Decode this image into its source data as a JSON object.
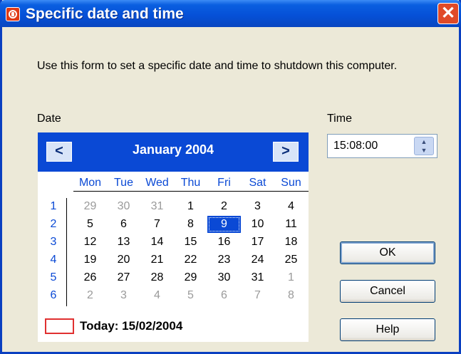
{
  "window": {
    "title": "Specific date and time"
  },
  "description": "Use this form to set a specific date and time to shutdown this computer.",
  "labels": {
    "date": "Date",
    "time": "Time"
  },
  "calendar": {
    "month_label": "January 2004",
    "prev_label": "<",
    "next_label": ">",
    "weekdays": [
      "Mon",
      "Tue",
      "Wed",
      "Thu",
      "Fri",
      "Sat",
      "Sun"
    ],
    "weeks": [
      {
        "num": "1",
        "days": [
          {
            "d": "29",
            "other": true
          },
          {
            "d": "30",
            "other": true
          },
          {
            "d": "31",
            "other": true
          },
          {
            "d": "1"
          },
          {
            "d": "2"
          },
          {
            "d": "3"
          },
          {
            "d": "4"
          }
        ]
      },
      {
        "num": "2",
        "days": [
          {
            "d": "5"
          },
          {
            "d": "6"
          },
          {
            "d": "7"
          },
          {
            "d": "8"
          },
          {
            "d": "9",
            "selected": true
          },
          {
            "d": "10"
          },
          {
            "d": "11"
          }
        ]
      },
      {
        "num": "3",
        "days": [
          {
            "d": "12"
          },
          {
            "d": "13"
          },
          {
            "d": "14"
          },
          {
            "d": "15"
          },
          {
            "d": "16"
          },
          {
            "d": "17"
          },
          {
            "d": "18"
          }
        ]
      },
      {
        "num": "4",
        "days": [
          {
            "d": "19"
          },
          {
            "d": "20"
          },
          {
            "d": "21"
          },
          {
            "d": "22"
          },
          {
            "d": "23"
          },
          {
            "d": "24"
          },
          {
            "d": "25"
          }
        ]
      },
      {
        "num": "5",
        "days": [
          {
            "d": "26"
          },
          {
            "d": "27"
          },
          {
            "d": "28"
          },
          {
            "d": "29"
          },
          {
            "d": "30"
          },
          {
            "d": "31"
          },
          {
            "d": "1",
            "other": true
          }
        ]
      },
      {
        "num": "6",
        "days": [
          {
            "d": "2",
            "other": true
          },
          {
            "d": "3",
            "other": true
          },
          {
            "d": "4",
            "other": true
          },
          {
            "d": "5",
            "other": true
          },
          {
            "d": "6",
            "other": true
          },
          {
            "d": "7",
            "other": true
          },
          {
            "d": "8",
            "other": true
          }
        ]
      }
    ],
    "today_label": "Today: 15/02/2004"
  },
  "time": {
    "value": "15:08:00",
    "spin_up": "▲",
    "spin_down": "▼"
  },
  "buttons": {
    "ok": "OK",
    "cancel": "Cancel",
    "help": "Help"
  },
  "close_label": "✕",
  "colors": {
    "title_bar": "#0651D8",
    "calendar_header": "#0A49D5",
    "today_marker": "#E03030"
  }
}
